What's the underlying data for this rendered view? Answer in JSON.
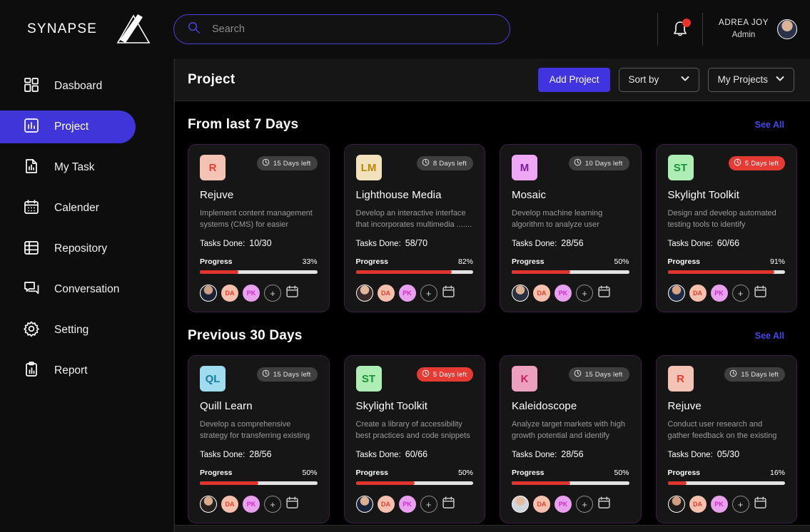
{
  "brand": {
    "name": "SYNAPSE",
    "logo_icon": "triangle-logo-icon"
  },
  "search": {
    "placeholder": "Search",
    "value": "",
    "icon": "search-icon"
  },
  "user": {
    "name": "ADREA JOY",
    "role": "Admin",
    "notification_icon": "bell-icon",
    "has_unread": true
  },
  "sidebar": {
    "items": [
      {
        "label": "Dasboard",
        "icon": "grid-icon",
        "active": false
      },
      {
        "label": "Project",
        "icon": "bar-chart-icon",
        "active": true
      },
      {
        "label": "My Task",
        "icon": "document-chart-icon",
        "active": false
      },
      {
        "label": "Calender",
        "icon": "calendar-icon",
        "active": false
      },
      {
        "label": "Repository",
        "icon": "table-icon",
        "active": false
      },
      {
        "label": "Conversation",
        "icon": "chat-bubbles-icon",
        "active": false
      },
      {
        "label": "Setting",
        "icon": "gear-icon",
        "active": false
      },
      {
        "label": "Report",
        "icon": "clipboard-chart-icon",
        "active": false
      }
    ]
  },
  "header": {
    "title": "Project",
    "add_project_label": "Add Project",
    "sort_by_label": "Sort by",
    "my_projects_label": "My Projects"
  },
  "colors": {
    "accent_blue": "#4035d8",
    "link_blue": "#4747e8",
    "progress_red": "#e2342f",
    "urgent_red": "#e63a35",
    "card_bg": "#161616",
    "card_border": "#3a1f42"
  },
  "sections": [
    {
      "title": "From last 7 Days",
      "see_all_label": "See All",
      "cards": [
        {
          "initials": "R",
          "badge_bg": "#f4c3b6",
          "badge_fg": "#e8402f",
          "days_left": "15 Days left",
          "urgent": false,
          "title": "Rejuve",
          "description": "Implement content management systems (CMS) for easier content.....",
          "tasks_label": "Tasks Done:",
          "tasks_value": "10/30",
          "progress_label": "Progress",
          "progress_pct": "33%",
          "progress_value": 33,
          "members": [
            "DA",
            "PK"
          ],
          "add_label": "+"
        },
        {
          "initials": "LM",
          "badge_bg": "#f2e2bb",
          "badge_fg": "#b8860b",
          "days_left": "8 Days left",
          "urgent": false,
          "title": "Lighthouse Media",
          "description": "Develop an interactive interface that incorporates multimedia .......",
          "tasks_label": "Tasks Done:",
          "tasks_value": "58/70",
          "progress_label": "Progress",
          "progress_pct": "82%",
          "progress_value": 82,
          "members": [
            "DA",
            "PK"
          ],
          "add_label": "+"
        },
        {
          "initials": "M",
          "badge_bg": "#efa8f5",
          "badge_fg": "#7c1f9e",
          "days_left": "10 Days left",
          "urgent": false,
          "title": "Mosaic",
          "description": "Develop machine learning algorithm to analyze user ................",
          "tasks_label": "Tasks Done:",
          "tasks_value": "28/56",
          "progress_label": "Progress",
          "progress_pct": "50%",
          "progress_value": 50,
          "members": [
            "DA",
            "PK"
          ],
          "add_label": "+"
        },
        {
          "initials": "ST",
          "badge_bg": "#aeeeb4",
          "badge_fg": "#19933a",
          "days_left": "5 Days left",
          "urgent": true,
          "title": "Skylight Toolkit",
          "description": "Design and develop automated testing tools to identify potential....",
          "tasks_label": "Tasks Done:",
          "tasks_value": "60/66",
          "progress_label": "Progress",
          "progress_pct": "91%",
          "progress_value": 91,
          "members": [
            "DA",
            "PK"
          ],
          "add_label": "+"
        }
      ]
    },
    {
      "title": "Previous 30 Days",
      "see_all_label": "See All",
      "cards": [
        {
          "initials": "QL",
          "badge_bg": "#9fdcf0",
          "badge_fg": "#1a7f96",
          "days_left": "15 Days left",
          "urgent": false,
          "title": "Quill Learn",
          "description": "Develop a comprehensive strategy for transferring existing website.......",
          "tasks_label": "Tasks Done:",
          "tasks_value": "28/56",
          "progress_label": "Progress",
          "progress_pct": "50%",
          "progress_value": 50,
          "members": [
            "DA",
            "PK"
          ],
          "add_label": "+"
        },
        {
          "initials": "ST",
          "badge_bg": "#aeeeb4",
          "badge_fg": "#19933a",
          "days_left": "5 Days left",
          "urgent": true,
          "title": "Skylight Toolkit",
          "description": "Create a library of accessibility best practices and code snippets for........",
          "tasks_label": "Tasks Done:",
          "tasks_value": "60/66",
          "progress_label": "Progress",
          "progress_pct": "50%",
          "progress_value": 50,
          "members": [
            "DA",
            "PK"
          ],
          "add_label": "+"
        },
        {
          "initials": "K",
          "badge_bg": "#eda0bd",
          "badge_fg": "#c71f5e",
          "days_left": "15 Days left",
          "urgent": false,
          "title": "Kaleidoscope",
          "description": "Analyze target markets with high growth potential and identify the....",
          "tasks_label": "Tasks Done:",
          "tasks_value": "28/56",
          "progress_label": "Progress",
          "progress_pct": "50%",
          "progress_value": 50,
          "members": [
            "DA",
            "PK"
          ],
          "add_label": "+"
        },
        {
          "initials": "R",
          "badge_bg": "#f4c3b6",
          "badge_fg": "#e8402f",
          "days_left": "15 Days left",
          "urgent": false,
          "title": "Rejuve",
          "description": "Conduct user research and gather feedback on the existing website's.",
          "tasks_label": "Tasks Done:",
          "tasks_value": "05/30",
          "progress_label": "Progress",
          "progress_pct": "16%",
          "progress_value": 16,
          "members": [
            "DA",
            "PK"
          ],
          "add_label": "+"
        }
      ]
    }
  ],
  "member_styles": {
    "DA": {
      "bg": "#f6c0ae",
      "fg": "#e8402f"
    },
    "PK": {
      "bg": "#e9a0ee",
      "fg": "#cc2fc9"
    }
  },
  "photo_gradients": [
    "radial-gradient(circle at 50% 30%, #caa184 0 32%, #1c2233 34% 100%)",
    "radial-gradient(circle at 50% 30%, #e0b89c 0 32%, #3a2a2a 34% 100%)",
    "radial-gradient(circle at 50% 30%, #dcae92 0 32%, #2a2f3d 34% 100%)",
    "radial-gradient(circle at 50% 30%, #d6a585 0 32%, #1f2a44 34% 100%)",
    "radial-gradient(circle at 50% 30%, #d8ab8e 0 32%, #26201e 34% 100%)",
    "radial-gradient(circle at 50% 30%, #dcb193 0 32%, #17243c 34% 100%)",
    "radial-gradient(circle at 50% 30%, #e3bb9e 0 32%, #cfd3da 34% 100%)",
    "radial-gradient(circle at 50% 30%, #cf9f80 0 32%, #201c1c 34% 100%)"
  ]
}
